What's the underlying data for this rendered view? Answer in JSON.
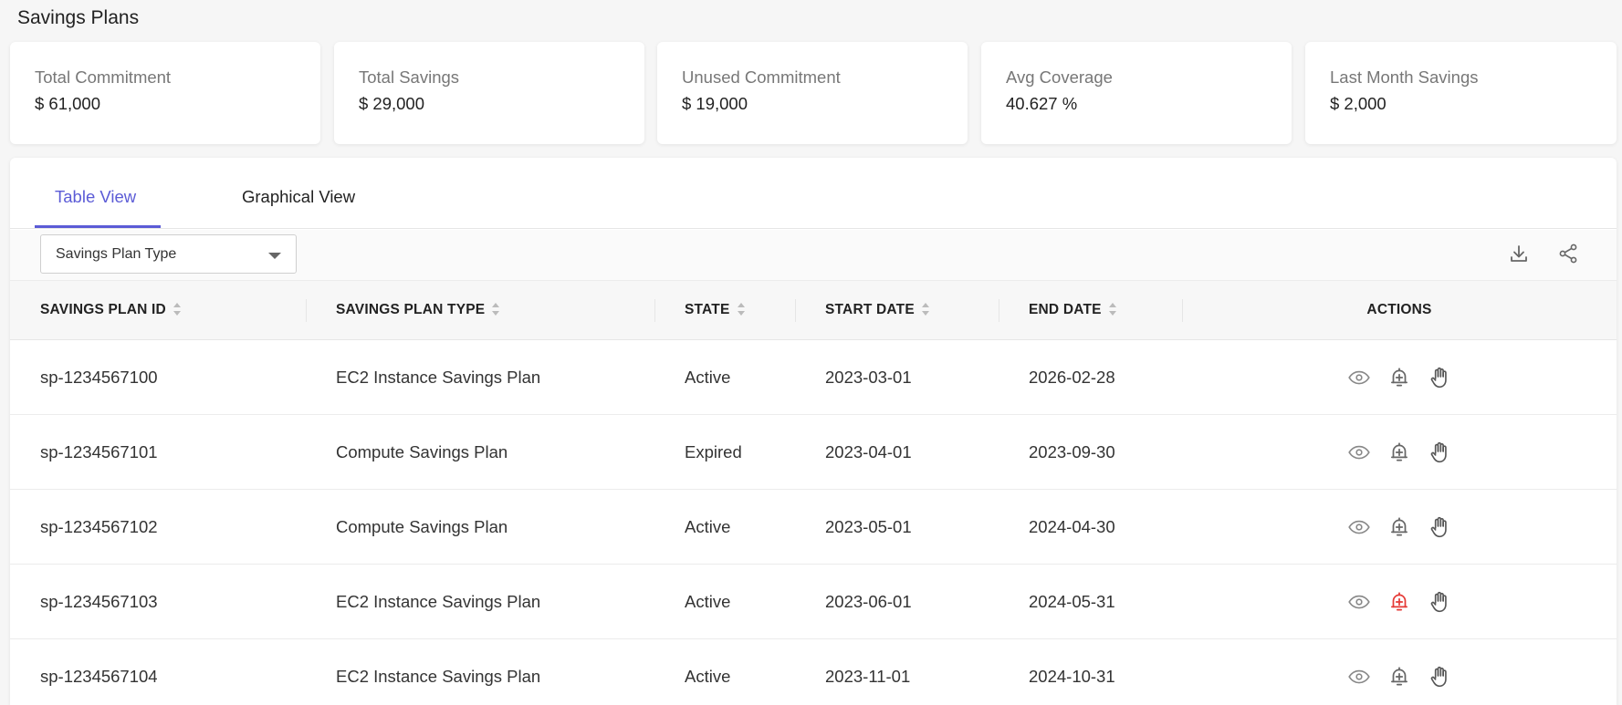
{
  "page": {
    "title": "Savings Plans"
  },
  "summary_cards": [
    {
      "label": "Total Commitment",
      "value": "$ 61,000"
    },
    {
      "label": "Total Savings",
      "value": "$ 29,000"
    },
    {
      "label": "Unused Commitment",
      "value": "$ 19,000"
    },
    {
      "label": "Avg Coverage",
      "value": "40.627 %"
    },
    {
      "label": "Last Month Savings",
      "value": "$ 2,000"
    }
  ],
  "tabs": [
    {
      "label": "Table View",
      "active": true
    },
    {
      "label": "Graphical View",
      "active": false
    }
  ],
  "toolbar": {
    "filter_selected": "Savings Plan Type",
    "icons": [
      "download-icon",
      "share-icon"
    ]
  },
  "table": {
    "columns": [
      "SAVINGS PLAN ID",
      "SAVINGS PLAN TYPE",
      "STATE",
      "START DATE",
      "END DATE",
      "ACTIONS"
    ],
    "rows": [
      {
        "id": "sp-1234567100",
        "type": "EC2 Instance Savings Plan",
        "state": "Active",
        "start": "2023-03-01",
        "end": "2026-02-28",
        "alert_active": false
      },
      {
        "id": "sp-1234567101",
        "type": "Compute Savings Plan",
        "state": "Expired",
        "start": "2023-04-01",
        "end": "2023-09-30",
        "alert_active": false
      },
      {
        "id": "sp-1234567102",
        "type": "Compute Savings Plan",
        "state": "Active",
        "start": "2023-05-01",
        "end": "2024-04-30",
        "alert_active": false
      },
      {
        "id": "sp-1234567103",
        "type": "EC2 Instance Savings Plan",
        "state": "Active",
        "start": "2023-06-01",
        "end": "2024-05-31",
        "alert_active": true
      },
      {
        "id": "sp-1234567104",
        "type": "EC2 Instance Savings Plan",
        "state": "Active",
        "start": "2023-11-01",
        "end": "2024-10-31",
        "alert_active": false
      }
    ],
    "action_icons": [
      "view-icon",
      "add-alert-icon",
      "hand-icon"
    ]
  },
  "colors": {
    "accent": "#5b5bd6",
    "alert_active": "#e53935",
    "icon": "#666666"
  }
}
